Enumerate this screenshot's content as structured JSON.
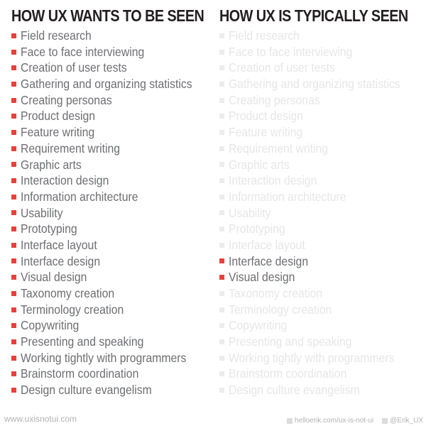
{
  "colors": {
    "accent": "#e8403a",
    "inactive": "#ececec",
    "text": "#6d6e71",
    "heading": "#231f20"
  },
  "left": {
    "title": "HOW UX WANTS TO BE SEEN",
    "items": [
      {
        "label": "Field research",
        "active": true
      },
      {
        "label": "Face to face interviewing",
        "active": true
      },
      {
        "label": "Creation of user tests",
        "active": true
      },
      {
        "label": "Gathering and organizing statistics",
        "active": true
      },
      {
        "label": "Creating personas",
        "active": true
      },
      {
        "label": "Product design",
        "active": true
      },
      {
        "label": "Feature writing",
        "active": true
      },
      {
        "label": "Requirement writing",
        "active": true
      },
      {
        "label": "Graphic arts",
        "active": true
      },
      {
        "label": "Interaction design",
        "active": true
      },
      {
        "label": "Information architecture",
        "active": true
      },
      {
        "label": "Usability",
        "active": true
      },
      {
        "label": "Prototyping",
        "active": true
      },
      {
        "label": "Interface layout",
        "active": true
      },
      {
        "label": "Interface design",
        "active": true
      },
      {
        "label": "Visual design",
        "active": true
      },
      {
        "label": "Taxonomy creation",
        "active": true
      },
      {
        "label": "Terminology creation",
        "active": true
      },
      {
        "label": "Copywriting",
        "active": true
      },
      {
        "label": "Presenting and speaking",
        "active": true
      },
      {
        "label": "Working tightly with programmers",
        "active": true
      },
      {
        "label": "Brainstorm coordination",
        "active": true
      },
      {
        "label": "Design culture evangelism",
        "active": true
      }
    ]
  },
  "right": {
    "title": "HOW UX IS TYPICALLY SEEN",
    "items": [
      {
        "label": "Field research",
        "active": false
      },
      {
        "label": "Face to face interviewing",
        "active": false
      },
      {
        "label": "Creation of user tests",
        "active": false
      },
      {
        "label": "Gathering and organizing statistics",
        "active": false
      },
      {
        "label": "Creating personas",
        "active": false
      },
      {
        "label": "Product design",
        "active": false
      },
      {
        "label": "Feature writing",
        "active": false
      },
      {
        "label": "Requirement writing",
        "active": false
      },
      {
        "label": "Graphic arts",
        "active": false
      },
      {
        "label": "Interaction design",
        "active": false
      },
      {
        "label": "Information architecture",
        "active": false
      },
      {
        "label": "Usability",
        "active": false
      },
      {
        "label": "Prototyping",
        "active": false
      },
      {
        "label": "Interface layout",
        "active": false
      },
      {
        "label": "Interface design",
        "active": true
      },
      {
        "label": "Visual design",
        "active": true
      },
      {
        "label": "Taxonomy creation",
        "active": false
      },
      {
        "label": "Terminology creation",
        "active": false
      },
      {
        "label": "Copywriting",
        "active": false
      },
      {
        "label": "Presenting and speaking",
        "active": false
      },
      {
        "label": "Working tightly with programmers",
        "active": false
      },
      {
        "label": "Brainstorm coordination",
        "active": false
      },
      {
        "label": "Design culture evangelism",
        "active": false
      }
    ]
  },
  "footer": {
    "site": "www.uxisnotui.com",
    "link": "helloerik.com/ux-is-not-ui",
    "link_icon": "linkedin-icon",
    "handle": "@Erik_UX",
    "handle_icon": "twitter-icon"
  }
}
